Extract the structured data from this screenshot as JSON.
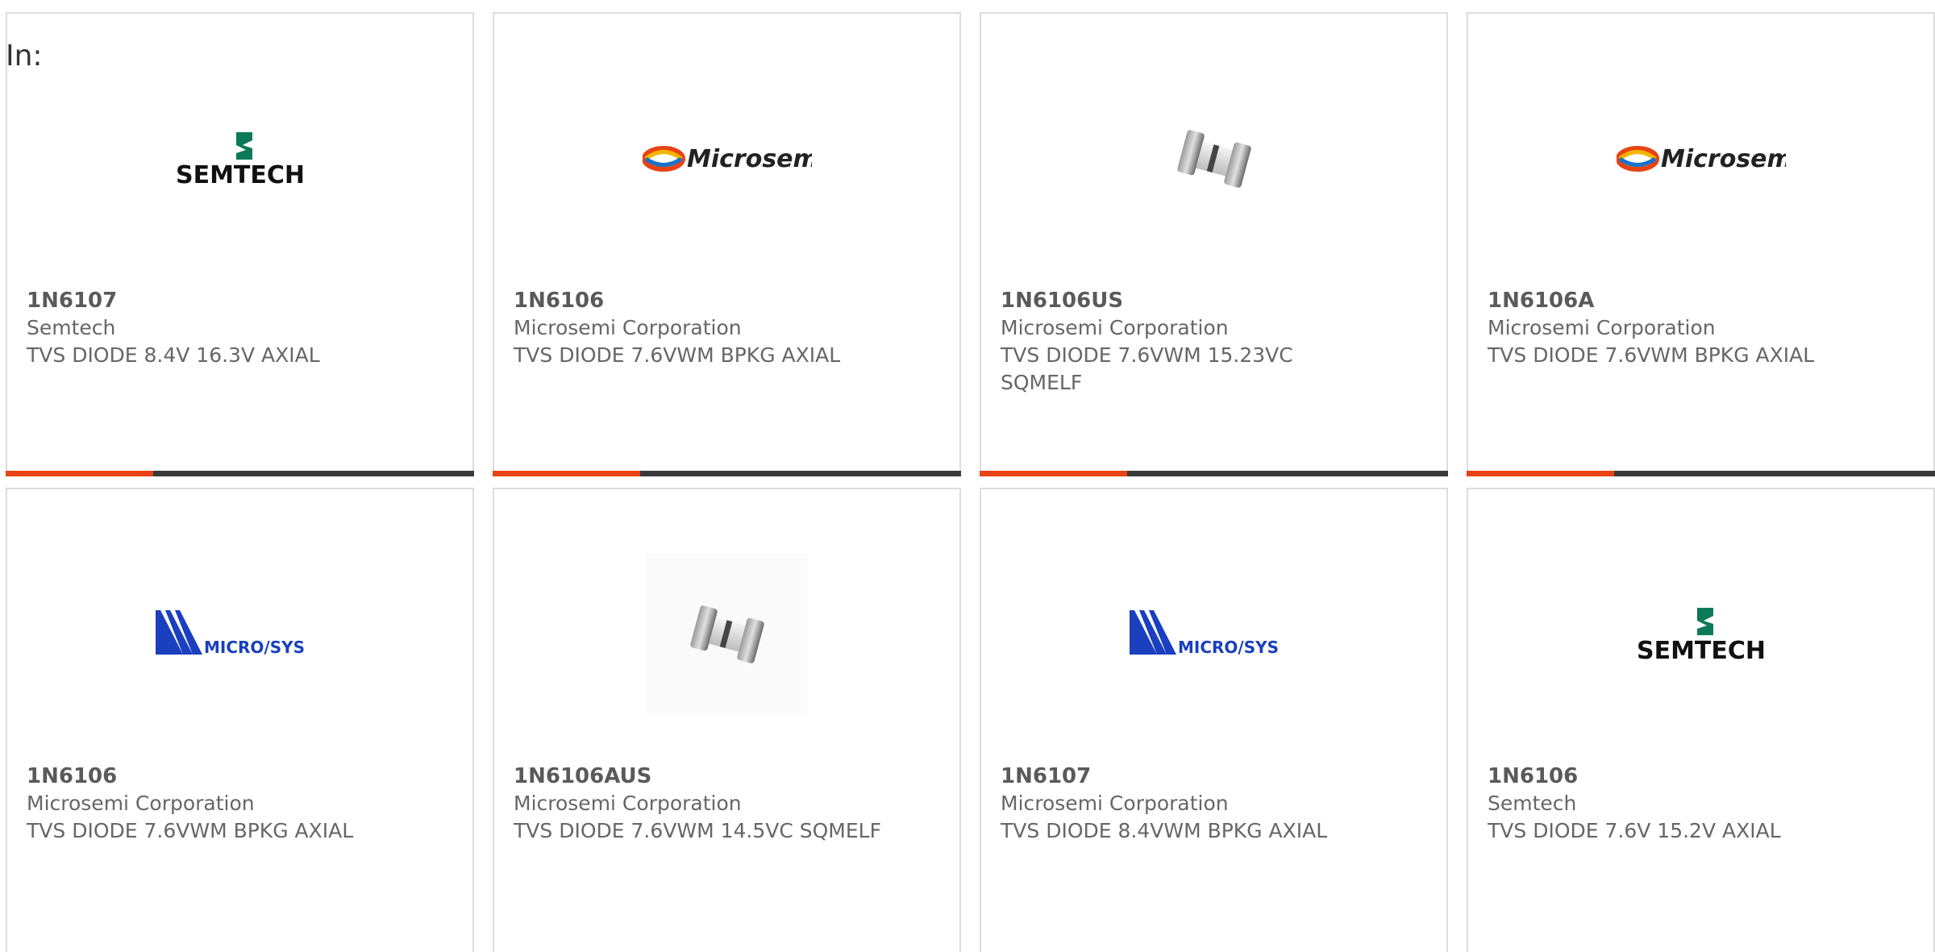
{
  "filter": {
    "label": "In:"
  },
  "brand_colors": {
    "accent": "#e84315",
    "bar": "#3a3a3a",
    "semtech_green": "#0c7a56",
    "microsys_blue": "#1a3fbf"
  },
  "products": [
    {
      "part": "1N6107",
      "manufacturer": "Semtech",
      "description": "TVS DIODE 8.4V 16.3V AXIAL",
      "image": "semtech-logo",
      "logo_text": "SEMTECH"
    },
    {
      "part": "1N6106",
      "manufacturer": "Microsemi Corporation",
      "description": "TVS DIODE 7.6VWM BPKG AXIAL",
      "image": "microsemi-logo",
      "logo_text": "Microsemi"
    },
    {
      "part": "1N6106US",
      "manufacturer": "Microsemi Corporation",
      "description": "TVS DIODE 7.6VWM 15.23VC SQMELF",
      "image": "diode-photo",
      "logo_text": ""
    },
    {
      "part": "1N6106A",
      "manufacturer": "Microsemi Corporation",
      "description": "TVS DIODE 7.6VWM BPKG AXIAL",
      "image": "microsemi-logo",
      "logo_text": "Microsemi"
    },
    {
      "part": "1N6106",
      "manufacturer": "Microsemi Corporation",
      "description": "TVS DIODE 7.6VWM BPKG AXIAL",
      "image": "microsys-logo",
      "logo_text": "MICRO/SYS"
    },
    {
      "part": "1N6106AUS",
      "manufacturer": "Microsemi Corporation",
      "description": "TVS DIODE 7.6VWM 14.5VC SQMELF",
      "image": "diode-photo",
      "logo_text": ""
    },
    {
      "part": "1N6107",
      "manufacturer": "Microsemi Corporation",
      "description": "TVS DIODE 8.4VWM BPKG AXIAL",
      "image": "microsys-logo",
      "logo_text": "MICRO/SYS"
    },
    {
      "part": "1N6106",
      "manufacturer": "Semtech",
      "description": "TVS DIODE 7.6V 15.2V AXIAL",
      "image": "semtech-logo",
      "logo_text": "SEMTECH"
    }
  ]
}
